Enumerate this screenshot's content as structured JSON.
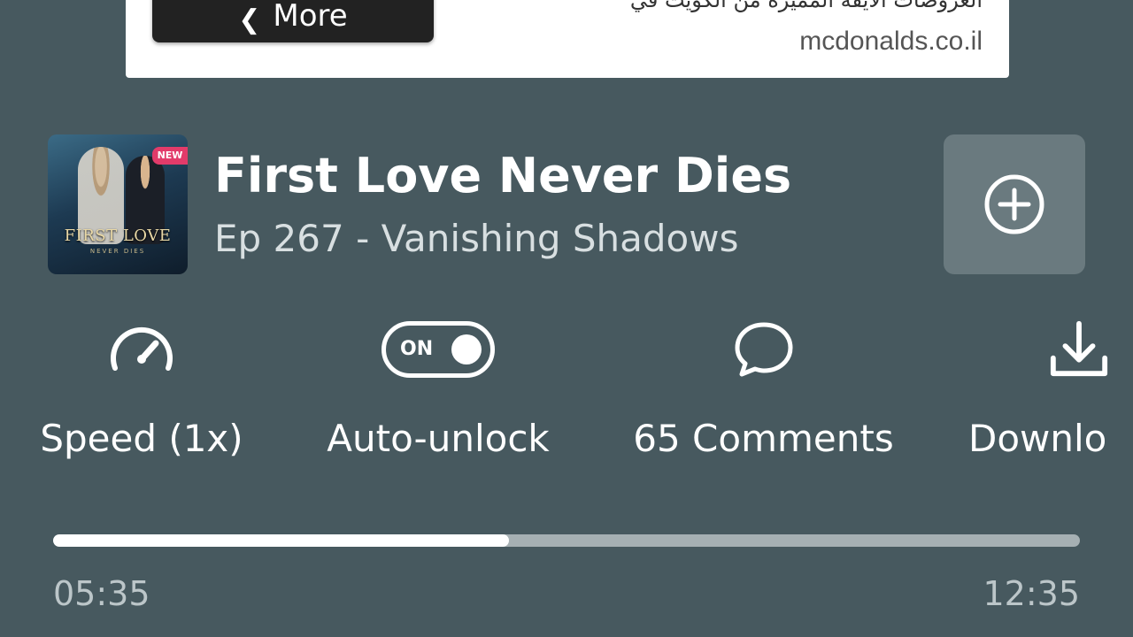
{
  "ad": {
    "more_label": "More",
    "headline": "العروضات الأيقة المميزة من الكويت في",
    "domain": "mcdonalds.co.il"
  },
  "episode": {
    "cover_badge": "NEW",
    "cover_title": "FIRST LOVE",
    "cover_subtitle": "NEVER DIES",
    "book_title": "First Love Never Dies",
    "episode_title": "Ep 267 - Vanishing Shadows"
  },
  "actions": {
    "speed_label": "Speed (1x)",
    "autounlock_label": "Auto-unlock",
    "autounlock_toggle_text": "ON",
    "comments_label": "65 Comments",
    "download_label": "Downlo"
  },
  "player": {
    "elapsed": "05:35",
    "total": "12:35",
    "progress_fraction": 0.444
  },
  "icons": {
    "add": "plus-circle-icon",
    "speed": "speedometer-icon",
    "comments": "chat-bubble-icon",
    "download": "download-icon"
  },
  "colors": {
    "background": "#47595f",
    "add_button_bg": "#6a7a7f",
    "progress_fill": "#ffffff",
    "progress_track": "#a6b0b3"
  }
}
